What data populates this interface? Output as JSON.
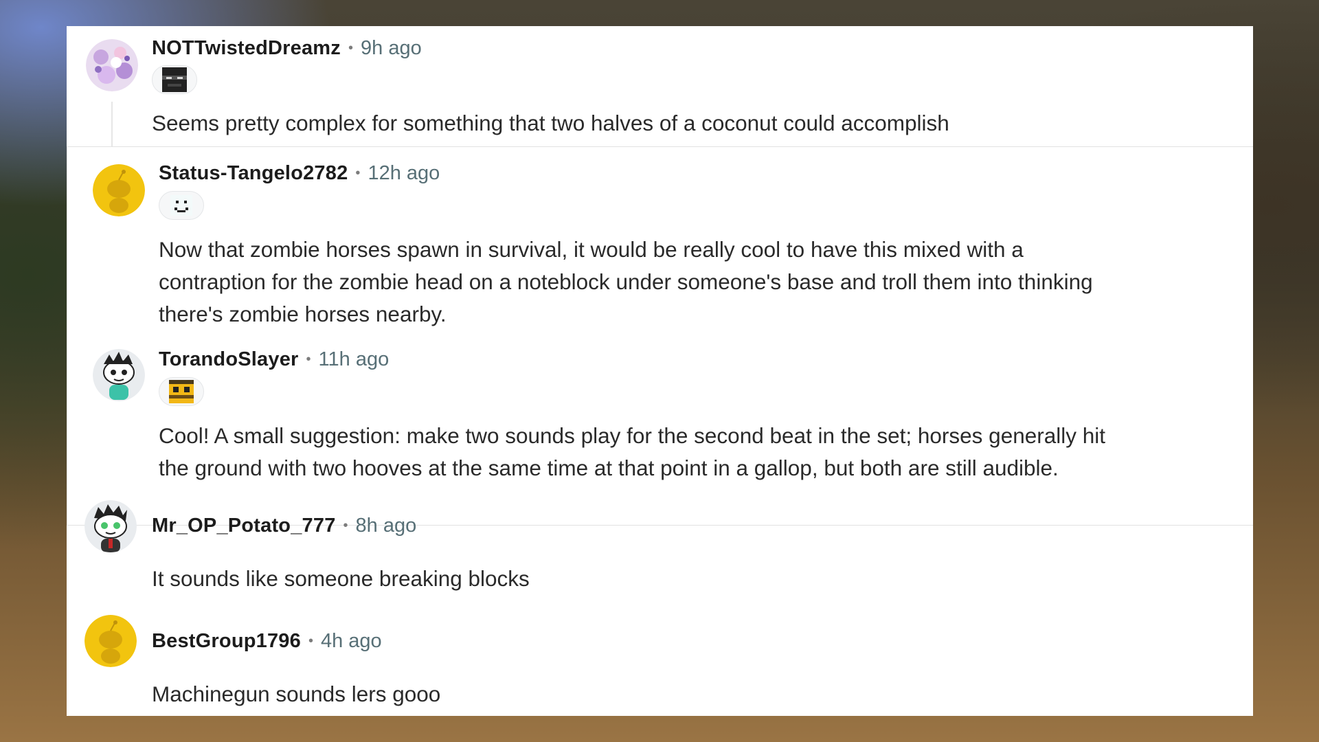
{
  "comments": [
    {
      "username": "NOTTwistedDreamz",
      "separator": "•",
      "time": "9h ago",
      "avatar_icon": "pastel-cloud-avatar-icon",
      "flair_icon": "pixel-block-face-icon",
      "body": [
        "Seems pretty complex for something that two halves of a coconut could accomplish"
      ]
    },
    {
      "username": "Status-Tangelo2782",
      "separator": "•",
      "time": "12h ago",
      "avatar_icon": "yellow-snoo-avatar-icon",
      "flair_icon": "pixel-smile-face-icon",
      "body": [
        "Now that zombie horses spawn in survival, it would be really cool to have this mixed with a",
        "contraption for the zombie head on a noteblock under someone's base and troll them into thinking",
        "there's zombie horses nearby."
      ]
    },
    {
      "username": "TorandoSlayer",
      "separator": "•",
      "time": "11h ago",
      "avatar_icon": "snoo-spiky-hair-avatar-icon",
      "flair_icon": "pixel-bee-face-icon",
      "body": [
        "Cool! A small suggestion: make two sounds play for the second beat in the set; horses generally hit",
        "the ground with two hooves at the same time at that point in a gallop, but both are still audible."
      ]
    },
    {
      "username": "Mr_OP_Potato_777",
      "separator": "•",
      "time": "8h ago",
      "avatar_icon": "snoo-green-eyes-avatar-icon",
      "flair_icon": "",
      "body": [
        "It sounds like someone breaking blocks"
      ]
    },
    {
      "username": "BestGroup1796",
      "separator": "•",
      "time": "4h ago",
      "avatar_icon": "yellow-snoo-avatar-icon",
      "flair_icon": "",
      "body": [
        "Machinegun sounds lers gooo"
      ]
    }
  ],
  "colors": {
    "username": "#1c1c1c",
    "timestamp": "#576f76",
    "body_text": "#2a2a2a",
    "snoo_yellow": "#f2c40f"
  }
}
